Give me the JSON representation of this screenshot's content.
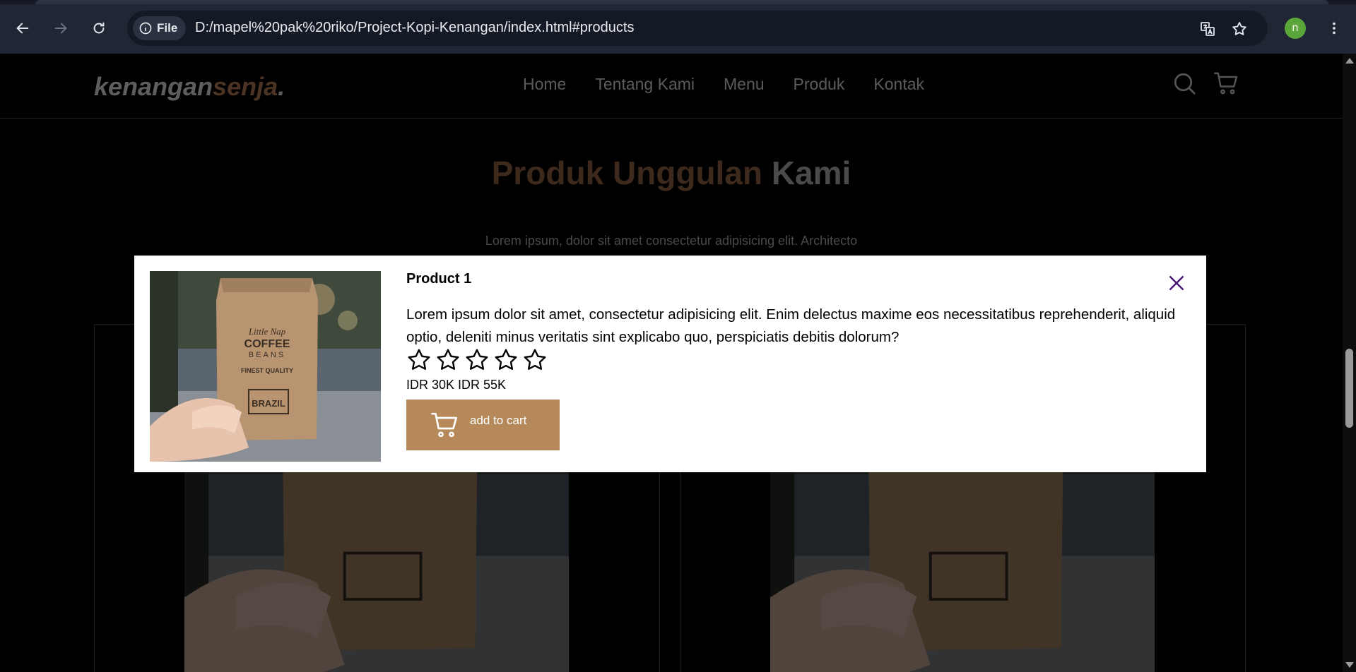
{
  "browser": {
    "site_chip_label": "File",
    "url": "D:/mapel%20pak%20riko/Project-Kopi-Kenangan/index.html#products",
    "profile_initial": "n"
  },
  "site": {
    "logo_part1": "kenangan",
    "logo_part2": "senja",
    "logo_part3": ".",
    "nav": [
      "Home",
      "Tentang Kami",
      "Menu",
      "Produk",
      "Kontak"
    ]
  },
  "section": {
    "title_part1": "Produk Unggulan",
    "title_part2": "Kami",
    "subtitle": "Lorem ipsum, dolor sit amet consectetur adipisicing elit. Architecto"
  },
  "product_image": {
    "brand": "Little Nap",
    "line1": "COFFEE",
    "line2": "BEANS",
    "tag": "FINEST QUALITY",
    "origin": "BRAZIL"
  },
  "modal": {
    "title": "Product 1",
    "description": "Lorem ipsum dolor sit amet, consectetur adipisicing elit. Enim delectus maxime eos necessitatibus reprehenderit, aliquid optio, deleniti minus veritatis sint explicabo quo, perspiciatis debitis dolorum?",
    "rating": 0,
    "rating_max": 5,
    "price": "IDR 30K IDR 55K",
    "cart_label": "add to cart"
  },
  "colors": {
    "accent": "#b6895b",
    "close_icon": "#4b1777"
  }
}
